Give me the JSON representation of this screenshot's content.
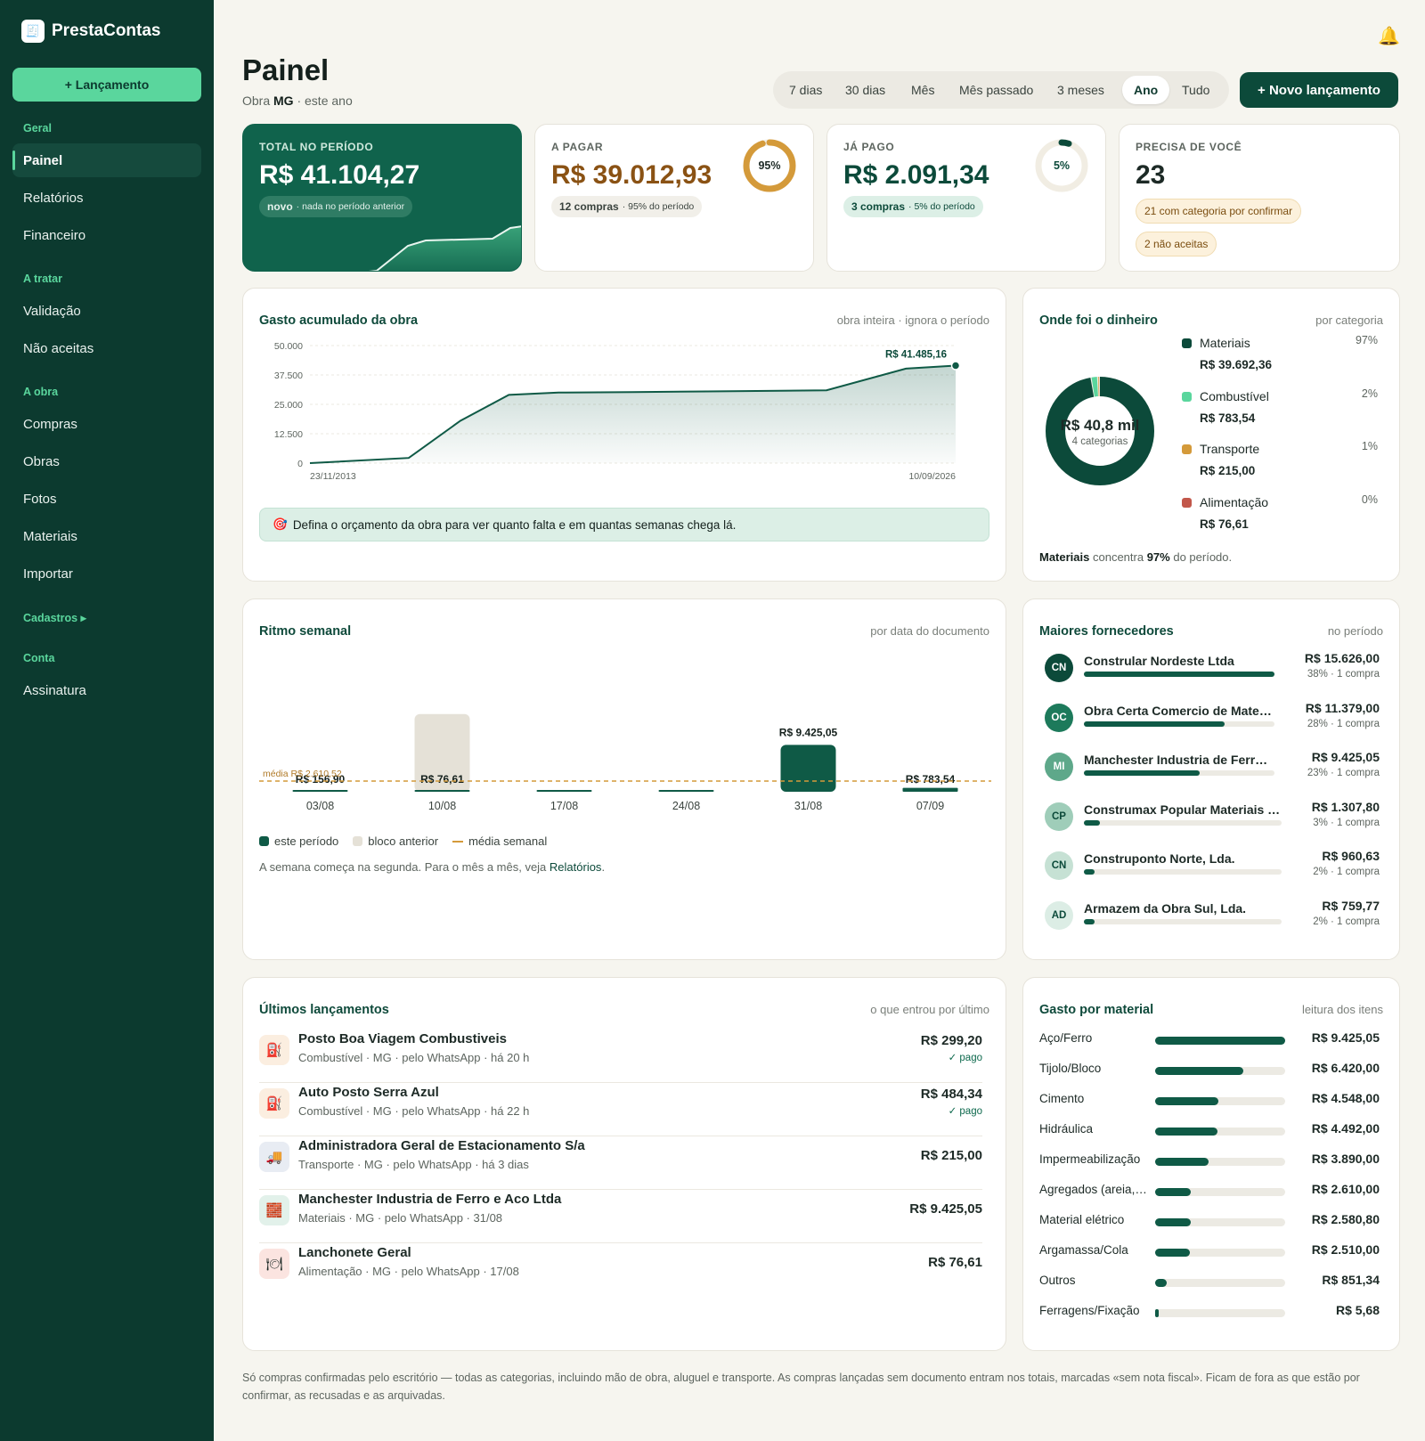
{
  "app": {
    "name": "PrestaContas",
    "logo_icon": "receipt-icon"
  },
  "sidebar": {
    "new_button": "+ Lançamento",
    "sections": [
      {
        "title": "Geral",
        "items": [
          {
            "label": "Painel",
            "active": true
          },
          {
            "label": "Relatórios"
          },
          {
            "label": "Financeiro"
          }
        ]
      },
      {
        "title": "A tratar",
        "items": [
          {
            "label": "Validação"
          },
          {
            "label": "Não aceitas"
          }
        ]
      },
      {
        "title": "A obra",
        "items": [
          {
            "label": "Compras"
          },
          {
            "label": "Obras"
          },
          {
            "label": "Fotos"
          },
          {
            "label": "Materiais"
          },
          {
            "label": "Importar"
          }
        ]
      },
      {
        "title": "Cadastros ▸",
        "items": []
      },
      {
        "title": "Conta",
        "items": [
          {
            "label": "Assinatura"
          }
        ]
      }
    ]
  },
  "header": {
    "title": "Painel",
    "subtitle_pre": "Obra ",
    "subtitle_bold": "MG",
    "subtitle_post": " · este ano",
    "notification_icon": "bell-icon"
  },
  "periods": {
    "options": [
      "7 dias",
      "30 dias",
      "Mês",
      "Mês passado",
      "3 meses",
      "Ano",
      "Tudo"
    ],
    "selected": "Ano"
  },
  "new_entry_button": "+ Novo lançamento",
  "kpis": {
    "total": {
      "label": "TOTAL NO PERÍODO",
      "value": "R$ 41.104,27",
      "badge_bold": "novo",
      "badge_text": "· nada no período anterior"
    },
    "a_pagar": {
      "label": "A PAGAR",
      "value": "R$ 39.012,93",
      "ring_label": "95%",
      "ring_fraction": 0.95,
      "pill_bold": "12 compras",
      "pill_text": "· 95% do período"
    },
    "ja_pago": {
      "label": "JÁ PAGO",
      "value": "R$ 2.091,34",
      "ring_label": "5%",
      "ring_fraction": 0.05,
      "pill_bold": "3 compras",
      "pill_text": "· 5% do período"
    },
    "precisa": {
      "label": "PRECISA DE VOCÊ",
      "value": "23",
      "pill1": "21 com categoria por confirmar",
      "pill2": "2 não aceitas"
    }
  },
  "cumulative": {
    "title": "Gasto acumulado da obra",
    "subtitle": "obra inteira · ignora o período",
    "last_label": "R$ 41.485,16",
    "hint": "Defina o orçamento da obra para ver quanto falta e em quantas semanas chega lá.",
    "hint_icon": "target-icon"
  },
  "money": {
    "title": "Onde foi o dinheiro",
    "subtitle": "por categoria",
    "center_value": "R$ 40,8 mil",
    "center_sub": "4 categorias",
    "footer_bold": "Materiais",
    "footer_mid": " concentra ",
    "footer_pct": "97%",
    "footer_end": " do período."
  },
  "weekly": {
    "title": "Ritmo semanal",
    "subtitle": "por data do documento",
    "avg_label": "média R$ 2.610,52",
    "legend": [
      "este período",
      "bloco anterior",
      "média semanal"
    ],
    "note_pre": "A semana começa na segunda. Para o mês a mês, veja ",
    "note_link": "Relatórios",
    "note_post": "."
  },
  "suppliers": {
    "title": "Maiores fornecedores",
    "subtitle": "no período",
    "items": [
      {
        "initials": "CN",
        "name": "Constrular Nordeste Ltda",
        "value": "R$ 15.626,00",
        "meta": "38% · 1 compra",
        "share": 0.38,
        "bg": "#0c4a3a",
        "fg": "#ffffff"
      },
      {
        "initials": "OC",
        "name": "Obra Certa Comercio de Materiais",
        "value": "R$ 11.379,00",
        "meta": "28% · 1 compra",
        "share": 0.28,
        "bg": "#1d7a5b",
        "fg": "#ffffff"
      },
      {
        "initials": "MI",
        "name": "Manchester Industria de Ferro e Aco",
        "value": "R$ 9.425,05",
        "meta": "23% · 1 compra",
        "share": 0.23,
        "bg": "#5ea88a",
        "fg": "#ffffff"
      },
      {
        "initials": "CP",
        "name": "Construmax Popular Materiais de Construção",
        "value": "R$ 1.307,80",
        "meta": "3% · 1 compra",
        "share": 0.03,
        "bg": "#9fcdb9",
        "fg": "#0c4a3a"
      },
      {
        "initials": "CN",
        "name": "Construponto Norte, Lda.",
        "value": "R$ 960,63",
        "meta": "2% · 1 compra",
        "share": 0.02,
        "bg": "#c6e1d4",
        "fg": "#0c4a3a"
      },
      {
        "initials": "AD",
        "name": "Armazem da Obra Sul, Lda.",
        "value": "R$ 759,77",
        "meta": "2% · 1 compra",
        "share": 0.02,
        "bg": "#dcede5",
        "fg": "#0c4a3a"
      }
    ]
  },
  "latest": {
    "title": "Últimos lançamentos",
    "subtitle": "o que entrou por último",
    "items": [
      {
        "icon": "fuel-pump-icon",
        "glyph": "⛽",
        "icon_bg": "#fbeee0",
        "name": "Posto Boa Viagem Combustiveis",
        "meta": "Combustível · MG · pelo WhatsApp · há 20 h",
        "value": "R$ 299,20",
        "status": "✓ pago"
      },
      {
        "icon": "fuel-pump-icon",
        "glyph": "⛽",
        "icon_bg": "#fbeee0",
        "name": "Auto Posto Serra Azul",
        "meta": "Combustível · MG · pelo WhatsApp · há 22 h",
        "value": "R$ 484,34",
        "status": "✓ pago"
      },
      {
        "icon": "truck-icon",
        "glyph": "🚚",
        "icon_bg": "#e8ecf3",
        "name": "Administradora Geral de Estacionamento S/a",
        "meta": "Transporte · MG · pelo WhatsApp · há 3 dias",
        "value": "R$ 215,00",
        "status": ""
      },
      {
        "icon": "brick-icon",
        "glyph": "🧱",
        "icon_bg": "#e2f1ea",
        "name": "Manchester Industria de Ferro e Aco Ltda",
        "meta": "Materiais · MG · pelo WhatsApp · 31/08",
        "value": "R$ 9.425,05",
        "status": ""
      },
      {
        "icon": "cutlery-icon",
        "glyph": "🍽",
        "icon_bg": "#fbe4e0",
        "name": "Lanchonete Geral",
        "meta": "Alimentação · MG · pelo WhatsApp · 17/08",
        "value": "R$ 76,61",
        "status": ""
      }
    ]
  },
  "materials": {
    "title": "Gasto por material",
    "subtitle": "leitura dos itens",
    "items": [
      {
        "name": "Aço/Ferro",
        "value": "R$ 9.425,05",
        "amount": 9425.05
      },
      {
        "name": "Tijolo/Bloco",
        "value": "R$ 6.420,00",
        "amount": 6420
      },
      {
        "name": "Cimento",
        "value": "R$ 4.548,00",
        "amount": 4548
      },
      {
        "name": "Hidráulica",
        "value": "R$ 4.492,00",
        "amount": 4492
      },
      {
        "name": "Impermeabilização",
        "value": "R$ 3.890,00",
        "amount": 3890
      },
      {
        "name": "Agregados (areia, brita)",
        "value": "R$ 2.610,00",
        "amount": 2610
      },
      {
        "name": "Material elétrico",
        "value": "R$ 2.580,80",
        "amount": 2580.8
      },
      {
        "name": "Argamassa/Cola",
        "value": "R$ 2.510,00",
        "amount": 2510
      },
      {
        "name": "Outros",
        "value": "R$ 851,34",
        "amount": 851.34
      },
      {
        "name": "Ferragens/Fixação",
        "value": "R$ 5,68",
        "amount": 5.68
      }
    ]
  },
  "footer": "Só compras confirmadas pelo escritório — todas as categorias, incluindo mão de obra, aluguel e transporte. As compras lançadas sem documento entram nos totais, marcadas «sem nota fiscal». Ficam de fora as que estão por confirmar, as recusadas e as arquivadas.",
  "colors": {
    "primary": "#0c4a3a",
    "accent": "#5ad69d",
    "warning": "#d49a3a",
    "danger": "#c2574a"
  },
  "chart_data": [
    {
      "type": "area",
      "title": "Gasto acumulado da obra",
      "x": [
        "23/11/2013",
        "2020-06",
        "2021-06",
        "2022-06",
        "2023-01",
        "2024-01",
        "2025-01",
        "2026-01",
        "2026-06",
        "10/09/2026"
      ],
      "x_positions": [
        0,
        0.153,
        0.233,
        0.308,
        0.385,
        0.5,
        0.615,
        0.8,
        0.923,
        1
      ],
      "values": [
        0,
        2200,
        18000,
        29000,
        30000,
        30200,
        30500,
        31000,
        40200,
        41485.16
      ],
      "yticks": [
        "0",
        "12.500",
        "25.000",
        "37.500",
        "50.000"
      ],
      "ylim": [
        0,
        50000
      ],
      "xticks": [
        "23/11/2013",
        "10/09/2026"
      ],
      "grid": true
    },
    {
      "type": "pie",
      "title": "Onde foi o dinheiro",
      "slices": [
        {
          "name": "Materiais",
          "value": 39692.36,
          "label": "R$ 39.692,36",
          "pct": "97%",
          "color": "#0c4a3a"
        },
        {
          "name": "Combustível",
          "value": 783.54,
          "label": "R$ 783,54",
          "pct": "2%",
          "color": "#5ad69d"
        },
        {
          "name": "Transporte",
          "value": 215,
          "label": "R$ 215,00",
          "pct": "1%",
          "color": "#d49a3a"
        },
        {
          "name": "Alimentação",
          "value": 76.61,
          "label": "R$ 76,61",
          "pct": "0%",
          "color": "#c2574a"
        }
      ]
    },
    {
      "type": "bar",
      "title": "Ritmo semanal",
      "categories": [
        "03/08",
        "10/08",
        "17/08",
        "24/08",
        "31/08",
        "07/09"
      ],
      "series": [
        {
          "name": "este período",
          "values": [
            156.9,
            76.61,
            0,
            0,
            9425.05,
            783.54
          ],
          "labels": [
            "R$ 156,90",
            "R$ 76,61",
            "",
            "",
            "R$ 9.425,05",
            "R$ 783,54"
          ]
        },
        {
          "name": "bloco anterior",
          "values": [
            0,
            15626,
            0,
            0,
            0,
            0
          ]
        }
      ],
      "average": 2610.52,
      "ylim": [
        0,
        17000
      ],
      "legend": "bottom-left"
    }
  ]
}
